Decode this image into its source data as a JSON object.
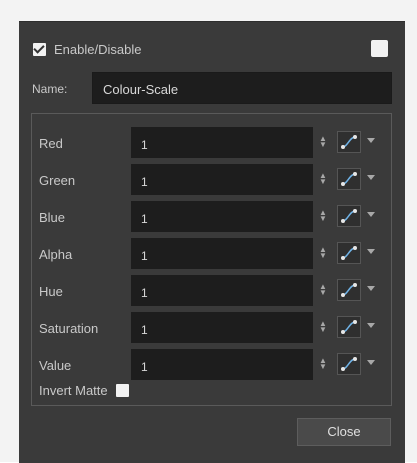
{
  "enable": {
    "label": "Enable/Disable",
    "checked": true
  },
  "name": {
    "label": "Name:",
    "value": "Colour-Scale"
  },
  "params": [
    {
      "label": "Red",
      "value": "1"
    },
    {
      "label": "Green",
      "value": "1"
    },
    {
      "label": "Blue",
      "value": "1"
    },
    {
      "label": "Alpha",
      "value": "1"
    },
    {
      "label": "Hue",
      "value": "1"
    },
    {
      "label": "Saturation",
      "value": "1"
    },
    {
      "label": "Value",
      "value": "1"
    }
  ],
  "invert_matte": {
    "label": "Invert Matte",
    "checked": false
  },
  "buttons": {
    "close": "Close"
  },
  "icons": {
    "checkbox": "checkbox-icon",
    "spinner": "spinner-arrows-icon",
    "function_curve": "function-curve-icon",
    "dropdown": "chevron-down-icon"
  },
  "colors": {
    "panel_bg": "#3a3a3a",
    "field_bg": "#1d1d1d",
    "accent": "#6fb2e6"
  }
}
